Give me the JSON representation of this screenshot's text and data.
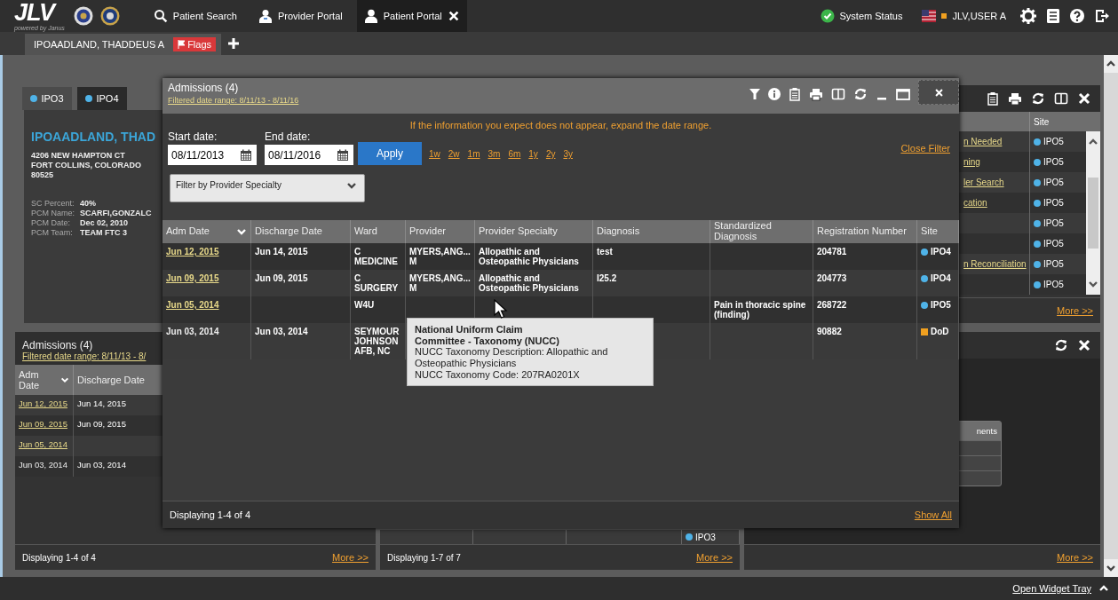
{
  "top_bar": {
    "logo": "JLV",
    "logo_subtitle": "powered by Janus",
    "nav": [
      {
        "label": "Patient Search",
        "selected": false,
        "closable": false
      },
      {
        "label": "Provider Portal",
        "selected": false,
        "closable": false
      },
      {
        "label": "Patient Portal",
        "selected": true,
        "closable": true
      }
    ],
    "system_status": "System Status",
    "user": "JLV,USER A"
  },
  "patient_tabs": [
    {
      "label": "IPOAADLAND, THADDEUS A",
      "selected": true,
      "badge": "Flags"
    }
  ],
  "patient_widget": {
    "site_tabs": [
      {
        "label": "IPO3",
        "selected": true
      },
      {
        "label": "IPO4",
        "selected": false
      }
    ],
    "name": "IPOAADLAND, THAD",
    "address": [
      "4206 NEW HAMPTON CT",
      "FORT COLLINS, COLORADO",
      "80525"
    ],
    "fields": [
      {
        "label": "SC Percent:",
        "value": "40%"
      },
      {
        "label": "PCM Name:",
        "value": "SCARFI,GONZALC"
      },
      {
        "label": "PCM Date:",
        "value": "Dec 02, 2010"
      },
      {
        "label": "PCM Team:",
        "value": "TEAM FTC 3"
      }
    ]
  },
  "admissions_widget": {
    "title": "Admissions (4)",
    "filter": "Filtered date range: 8/11/13 - 8/",
    "columns": [
      "Adm Date",
      "Discharge Date"
    ],
    "rows": [
      {
        "adm_date": "Jun 12, 2015",
        "link": true,
        "discharge_date": "Jun 14, 2015"
      },
      {
        "adm_date": "Jun 09, 2015",
        "link": true,
        "discharge_date": "Jun 09, 2015"
      },
      {
        "adm_date": "Jun 05, 2014",
        "link": true
      },
      {
        "adm_date": "Jun 03, 2014",
        "link": false,
        "discharge_date": "Jun 03, 2014"
      }
    ],
    "footer": "Displaying 1-4 of 4",
    "more": "More >>"
  },
  "middle_widget": {
    "rows": [
      {
        "site": "IPO3",
        "color": "#4fb3e8",
        "kind": "dot"
      }
    ],
    "footer": "Displaying 1-7 of 7",
    "more": "More >>"
  },
  "right_widget": {
    "columns": [
      "Site"
    ],
    "rows": [
      {
        "text": "n Needed",
        "site": "IPO5",
        "color": "#4fb3e8",
        "kind": "dot"
      },
      {
        "text": "ning",
        "site": "IPO5",
        "color": "#4fb3e8",
        "kind": "dot"
      },
      {
        "text": "ler Search",
        "site": "IPO5",
        "color": "#4fb3e8",
        "kind": "dot"
      },
      {
        "text": "cation",
        "site": "IPO5",
        "color": "#4fb3e8",
        "kind": "dot"
      },
      {
        "site": "IPO5",
        "color": "#4fb3e8",
        "kind": "dot"
      },
      {
        "site": "IPO5",
        "color": "#4fb3e8",
        "kind": "dot"
      },
      {
        "text": "n Reconciliation",
        "site": "IPO5",
        "color": "#4fb3e8",
        "kind": "dot"
      },
      {
        "site": "IPO5",
        "color": "#4fb3e8",
        "kind": "dot"
      }
    ],
    "more": "More >>"
  },
  "right_lower_widget": {
    "table_header": "nents",
    "more": "More >>"
  },
  "modal": {
    "title": "Admissions (4)",
    "filter": "Filtered date range: 8/11/13 - 8/11/16",
    "message": "If the information you expect does not appear, expand the date range.",
    "start_label": "Start date:",
    "start_value": "08/11/2013",
    "end_label": "End date:",
    "end_value": "08/11/2016",
    "apply": "Apply",
    "ranges": [
      "1w",
      "2w",
      "1m",
      "3m",
      "6m",
      "1y",
      "2y",
      "3y"
    ],
    "close_filter": "Close Filter",
    "specialty_filter": "Filter by Provider Specialty",
    "columns": [
      "Adm Date",
      "Discharge Date",
      "Ward",
      "Provider",
      "Provider Specialty",
      "Diagnosis",
      "Standardized Diagnosis",
      "Registration Number",
      "Site"
    ],
    "rows": [
      {
        "adm_date": "Jun 12, 2015",
        "link": true,
        "discharge_date": "Jun 14, 2015",
        "ward": "C MEDICINE",
        "provider": "MYERS,ANG... M",
        "specialty": "Allopathic and Osteopathic Physicians",
        "diagnosis": "test",
        "registration": "204781",
        "site": "IPO4",
        "color": "#4fb3e8",
        "kind": "dot"
      },
      {
        "adm_date": "Jun 09, 2015",
        "link": true,
        "discharge_date": "Jun 09, 2015",
        "ward": "C SURGERY",
        "provider": "MYERS,ANG... M",
        "specialty": "Allopathic and Osteopathic Physicians",
        "diagnosis": "I25.2",
        "registration": "204773",
        "site": "IPO4",
        "color": "#4fb3e8",
        "kind": "dot"
      },
      {
        "adm_date": "Jun 05, 2014",
        "link": true,
        "ward": "W4U",
        "std_diagnosis": "Pain in thoracic spine (finding)",
        "registration": "268722",
        "site": "IPO5",
        "color": "#4fb3e8",
        "kind": "dot"
      },
      {
        "adm_date": "Jun 03, 2014",
        "link": false,
        "discharge_date": "Jun 03, 2014",
        "ward": "SEYMOUR JOHNSON AFB, NC",
        "registration": "90882",
        "site": "DoD",
        "color": "#f0a020",
        "kind": "square"
      }
    ],
    "tooltip": {
      "title": "National Uniform Claim Committee - Taxonomy (NUCC)",
      "lines": [
        "NUCC Taxonomy Description: Allopathic and Osteopathic Physicians",
        "NUCC Taxonomy Code: 207RA0201X"
      ]
    },
    "footer": "Displaying 1-4 of 4",
    "show_all": "Show All"
  },
  "bottom_bar": {
    "link": "Open Widget Tray"
  }
}
